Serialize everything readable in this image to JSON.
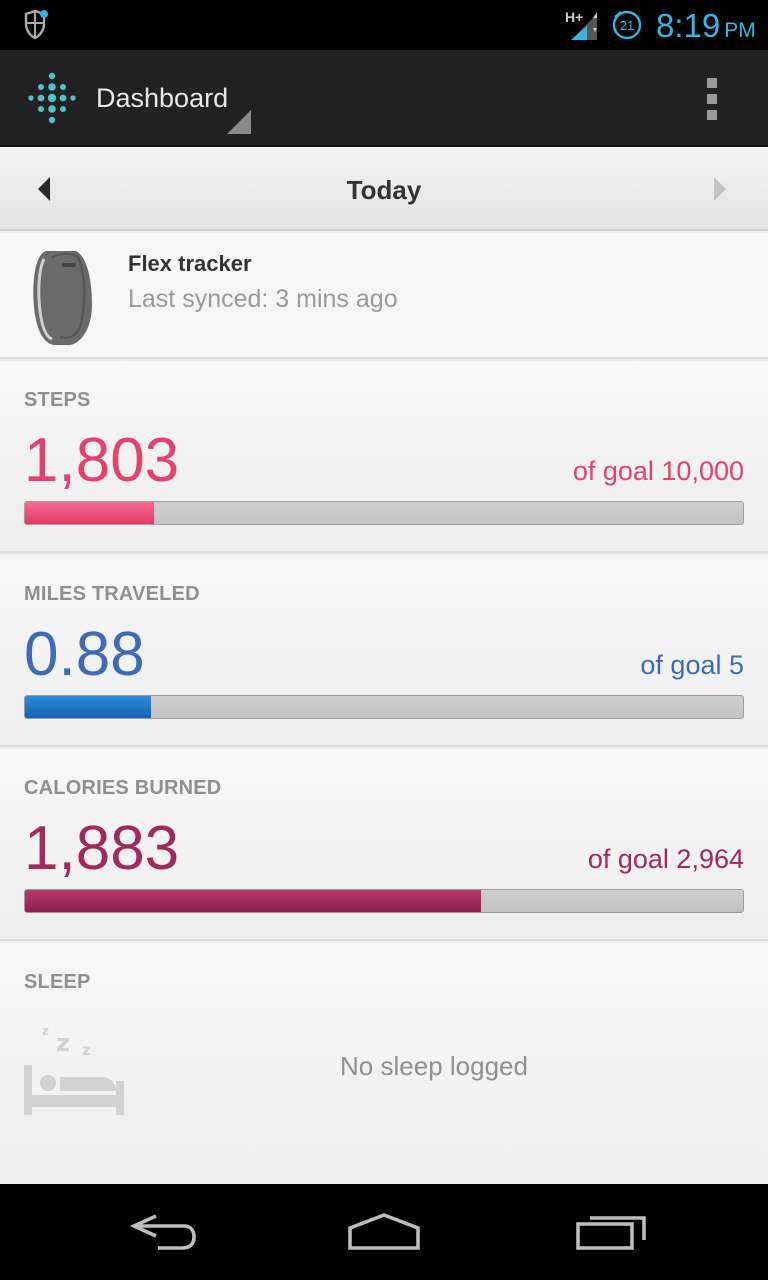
{
  "status_bar": {
    "time": "8:19",
    "ampm": "PM",
    "network": "H+",
    "alarm_badge": "21"
  },
  "action_bar": {
    "title": "Dashboard",
    "icons": [
      "fitbit-logo-icon",
      "overflow-menu-icon"
    ]
  },
  "date_nav": {
    "label": "Today"
  },
  "tracker": {
    "name": "Flex tracker",
    "last_synced": "Last synced: 3 mins ago"
  },
  "stats": {
    "steps": {
      "heading": "STEPS",
      "value": "1,803",
      "goal": "of goal 10,000",
      "progress_fraction": 0.18,
      "color": "#e6406f"
    },
    "miles": {
      "heading": "MILES TRAVELED",
      "value": "0.88",
      "goal": "of goal 5",
      "progress_fraction": 0.176,
      "color": "#3d6bb8"
    },
    "calories": {
      "heading": "CALORIES BURNED",
      "value": "1,883",
      "goal": "of goal 2,964",
      "progress_fraction": 0.635,
      "color": "#a3285b"
    }
  },
  "sleep": {
    "heading": "SLEEP",
    "empty_text": "No sleep logged"
  },
  "nav_bar": {
    "icons": [
      "back-icon",
      "home-icon",
      "recents-icon"
    ]
  }
}
